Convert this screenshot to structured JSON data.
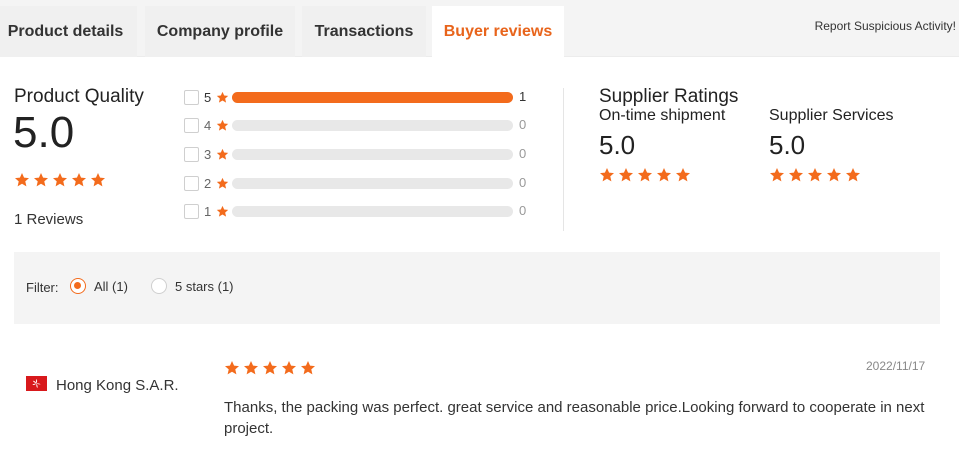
{
  "tabs": [
    {
      "label": "Product details",
      "active": false
    },
    {
      "label": "Company profile",
      "active": false
    },
    {
      "label": "Transactions",
      "active": false
    },
    {
      "label": "Buyer reviews",
      "active": true
    }
  ],
  "report_link": "Report Suspicious Activity!",
  "product_quality": {
    "title": "Product Quality",
    "score": "5.0",
    "stars": 5,
    "reviews_text": "1 Reviews",
    "breakdown": [
      {
        "star": "5",
        "count": "1",
        "fraction": 1.0
      },
      {
        "star": "4",
        "count": "0",
        "fraction": 0
      },
      {
        "star": "3",
        "count": "0",
        "fraction": 0
      },
      {
        "star": "2",
        "count": "0",
        "fraction": 0
      },
      {
        "star": "1",
        "count": "0",
        "fraction": 0
      }
    ]
  },
  "supplier_ratings": {
    "title": "Supplier Ratings",
    "items": [
      {
        "label": "On-time shipment",
        "score": "5.0",
        "stars": 5
      },
      {
        "label": "Supplier Services",
        "score": "5.0",
        "stars": 5
      }
    ]
  },
  "filter": {
    "label": "Filter:",
    "options": [
      {
        "label": "All (1)",
        "selected": true
      },
      {
        "label": "5 stars (1)",
        "selected": false
      }
    ]
  },
  "review": {
    "country": "Hong Kong S.A.R.",
    "flag_icon": "hong-kong-flag-icon",
    "stars": 5,
    "date": "2022/11/17",
    "text": "Thanks, the packing was perfect. great service and reasonable price.Looking forward to cooperate in next project."
  },
  "colors": {
    "accent": "#f36b1c",
    "active_tab_text": "#e8641b",
    "flag_red": "#d8191c"
  }
}
